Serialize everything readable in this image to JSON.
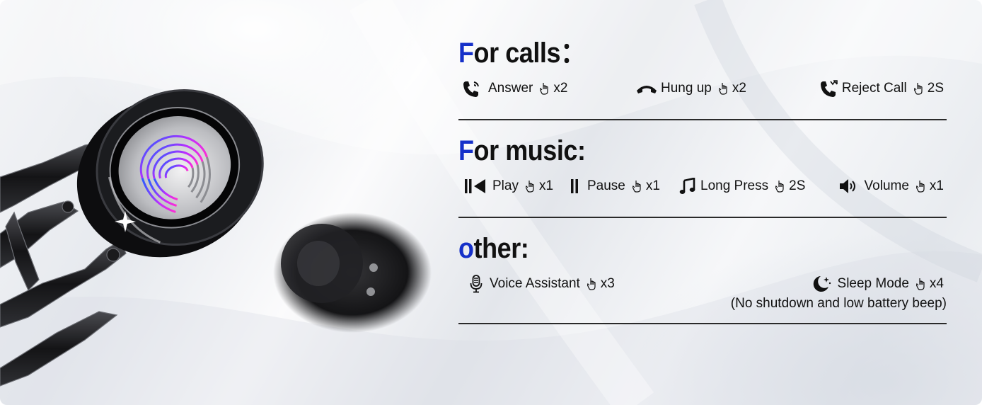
{
  "calls": {
    "title_first": "F",
    "title_rest": "or calls",
    "title_colon": "：",
    "answer_label": "Answer",
    "answer_count": "x2",
    "hangup_label": "Hung up",
    "hangup_count": "x2",
    "reject_label": "Reject Call",
    "reject_count": "2S"
  },
  "music": {
    "title_first": "F",
    "title_rest": "or music:",
    "play_label": "Play",
    "play_count": "x1",
    "pause_label": "Pause",
    "pause_count": "x1",
    "long_label": "Long Press",
    "long_count": "2S",
    "volume_label": "Volume",
    "volume_count": "x1"
  },
  "other": {
    "title_first": "o",
    "title_rest": "ther:",
    "voice_label": "Voice Assistant",
    "voice_count": "x3",
    "sleep_label": "Sleep Mode",
    "sleep_count": "x4",
    "sleep_note": "(No shutdown and low battery beep)"
  },
  "colors": {
    "accent": "#1530c9",
    "text": "#111111"
  },
  "icons": [
    "phone-answer-icon",
    "hang-up-icon",
    "reject-call-icon",
    "tap-icon",
    "play-icon",
    "pause-icon",
    "music-note-icon",
    "volume-icon",
    "microphone-icon",
    "moon-icon"
  ]
}
